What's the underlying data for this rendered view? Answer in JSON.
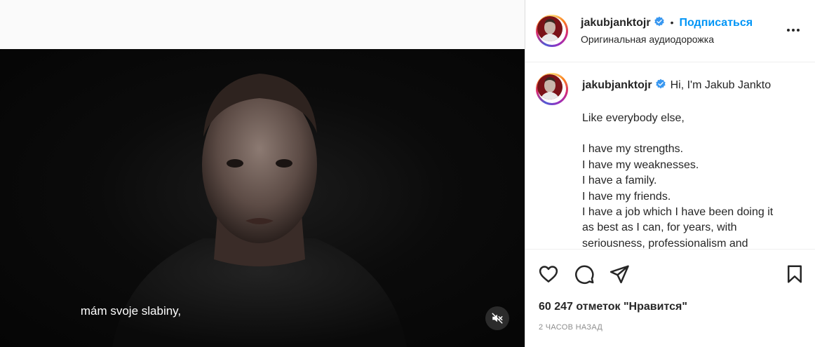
{
  "header": {
    "username": "jakubjanktojr",
    "separator": "•",
    "follow_label": "Подписаться",
    "audio_label": "Оригинальная аудиодорожка"
  },
  "caption": {
    "username": "jakubjanktojr",
    "first_line": "Hi, I'm Jakub Jankto",
    "lines": [
      "Like everybody else,",
      "",
      "I have my strengths.",
      "I have my weaknesses.",
      "I have a family.",
      "I have my friends.",
      "I have a job which I have been doing it",
      "as best as I can, for years, with",
      "seriousness, professionalism and"
    ]
  },
  "video": {
    "subtitle": "mám svoje slabiny,",
    "muted": true
  },
  "footer": {
    "likes": "60 247 отметок \"Нравится\"",
    "time": "2 ЧАСОВ НАЗАД"
  },
  "icons": [
    "verified-badge-icon",
    "more-options-icon",
    "like-heart-icon",
    "comment-icon",
    "share-icon",
    "save-bookmark-icon",
    "muted-speaker-icon"
  ],
  "colors": {
    "link": "#0095f6",
    "verified": "#3897f0",
    "muted_text": "#8e8e8e"
  }
}
